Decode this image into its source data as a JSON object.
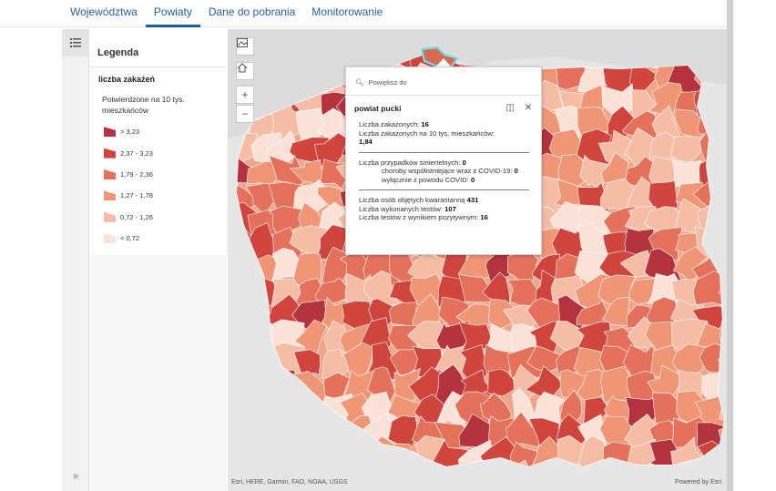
{
  "tabs": [
    {
      "label": "Województwa"
    },
    {
      "label": "Powiaty"
    },
    {
      "label": "Dane do pobrania"
    },
    {
      "label": "Monitorowanie"
    }
  ],
  "legend": {
    "title": "Legenda",
    "layer": "liczba zakażeń",
    "subtitle": "Potwierdzone na 10 tys. mieszkańców",
    "classes": [
      {
        "label": "> 3,23",
        "color": "#b3333f"
      },
      {
        "label": "2,37 - 3,23",
        "color": "#d0463f"
      },
      {
        "label": "1,79 - 2,36",
        "color": "#e4715c"
      },
      {
        "label": "1,27 - 1,78",
        "color": "#ef9677"
      },
      {
        "label": "0,72 - 1,26",
        "color": "#f5bda6"
      },
      {
        "label": "< 0,72",
        "color": "#fbe2d8"
      }
    ]
  },
  "map": {
    "attribution": "Esri, HERE, Garmin, FAO, NOAA, USGS",
    "powered_by": "Powered by Esri",
    "controls": [
      "image-icon",
      "home-icon",
      "zoom-in",
      "zoom-out"
    ]
  },
  "popup": {
    "zoom_label": "Powiększ do",
    "title": "powiat pucki",
    "infected_label": "Liczba zakażonych:",
    "infected_value": "16",
    "per10k_label": "Liczba zakażonych na 10 tys. mieszkańców:",
    "per10k_value": "1,84",
    "deaths_label": "Liczba przypadków śmiertelnych:",
    "deaths_value": "0",
    "comorb_label": "choroby współistniejące wraz z COVID-19:",
    "comorb_value": "0",
    "covid_only_label": "wyłącznie z powodu COVID:",
    "covid_only_value": "0",
    "quarantine_label": "Liczba osób objętych kwarantanną",
    "quarantine_value": "431",
    "tests_label": "Liczba wykonanych testów:",
    "tests_value": "107",
    "positive_label": "Liczba testów z wynikiem pozytywnym:",
    "positive_value": "16"
  }
}
